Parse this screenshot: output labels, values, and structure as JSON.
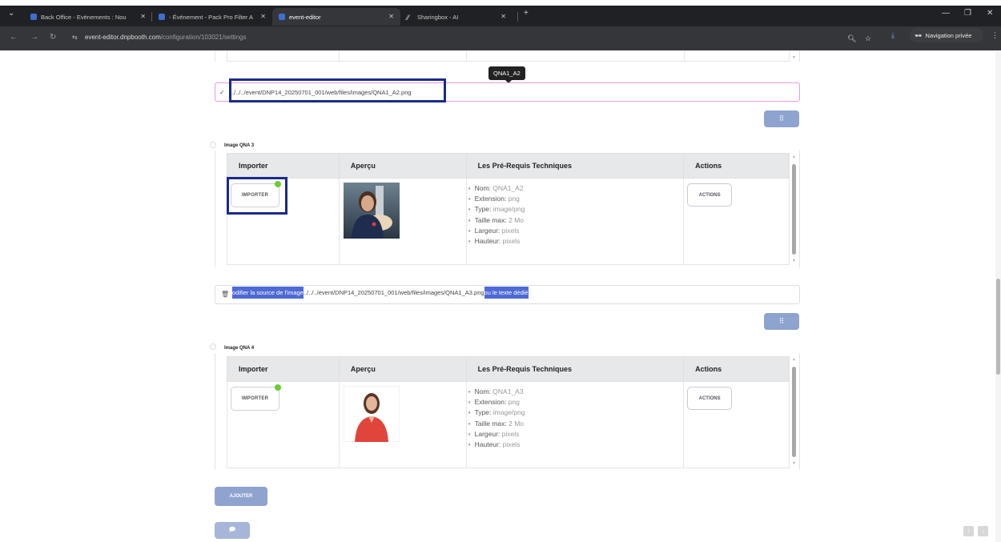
{
  "browser": {
    "tabs": [
      {
        "title": "Back Office - Evénements : Nou"
      },
      {
        "title": "- Événement - Pack Pro Filter A"
      },
      {
        "title": "event-editor"
      },
      {
        "title": "Sharingbox - AI"
      }
    ],
    "new_tab_icon": "plus-icon",
    "url_host": "event-editor.dnpbooth.com",
    "url_path": "/configuration/103021/settings",
    "incognito_label": "Navigation privée"
  },
  "tooltip": "QNA1_A2",
  "path_input_a2": "../../../event/DNP14_20250701_001/web/files/images/QNA1_A2.png",
  "path_input_a3": {
    "sel_prefix": "odifier la source de l'image",
    "path": "../../../event/DNP14_20250701_001/web/files/images/QNA1_A3.png",
    "sel_suffix": "ou le texte dédié"
  },
  "drag_icon": "⠿",
  "sections": [
    {
      "title": "Image QNA 3",
      "headers": [
        "Importer",
        "Aperçu",
        "Les Pré-Requis Techniques",
        "Actions"
      ],
      "import_label": "IMPORTER",
      "actions_label": "ACTIONS",
      "requirements": [
        {
          "k": "Nom:",
          "v": "QNA1_A2"
        },
        {
          "k": "Extension:",
          "v": "png"
        },
        {
          "k": "Type:",
          "v": "image/png"
        },
        {
          "k": "Taille max:",
          "v": "2 Mo"
        },
        {
          "k": "Largeur:",
          "v": "pixels"
        },
        {
          "k": "Hauteur:",
          "v": "pixels"
        }
      ]
    },
    {
      "title": "Image QNA 4",
      "headers": [
        "Importer",
        "Aperçu",
        "Les Pré-Requis Techniques",
        "Actions"
      ],
      "import_label": "IMPORTER",
      "actions_label": "ACTIONS",
      "requirements": [
        {
          "k": "Nom:",
          "v": "QNA1_A3"
        },
        {
          "k": "Extension:",
          "v": "png"
        },
        {
          "k": "Type:",
          "v": "image/png"
        },
        {
          "k": "Taille max:",
          "v": "2 Mo"
        },
        {
          "k": "Largeur:",
          "v": "pixels"
        },
        {
          "k": "Hauteur:",
          "v": "pixels"
        }
      ]
    }
  ],
  "add_button": "AJOUTER",
  "colors": {
    "accent": "#8fa3cf",
    "highlight": "#1a2a8c",
    "status_dot": "#6ccd32",
    "focus_border": "#e59ad9"
  }
}
